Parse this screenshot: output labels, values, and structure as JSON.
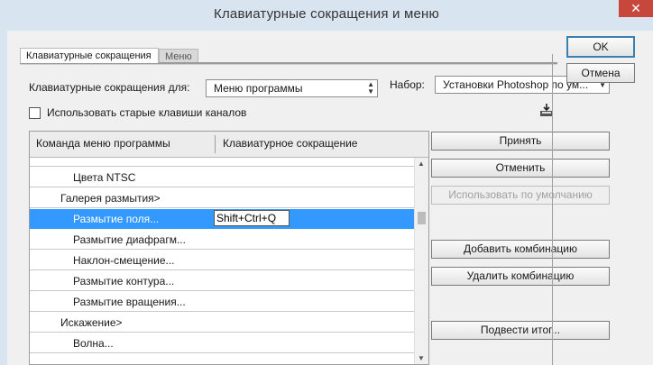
{
  "window": {
    "title": "Клавиатурные сокращения и меню",
    "close_glyph": "✕"
  },
  "tabs": [
    {
      "label": "Клавиатурные сокращения",
      "active": true
    },
    {
      "label": "Меню",
      "active": false
    }
  ],
  "controls": {
    "shortcuts_for_label": "Клавиатурные сокращения для:",
    "shortcuts_for_value": "Меню программы",
    "set_label": "Набор:",
    "set_value": "Установки Photoshop по ум...",
    "legacy_channels_label": "Использовать старые клавиши каналов",
    "legacy_channels_checked": false,
    "save_set_icon": "save-set-icon"
  },
  "table": {
    "columns": [
      "Команда меню программы",
      "Клавиатурное сокращение"
    ],
    "rows": [
      {
        "label": "Цвета NTSC",
        "shortcut": "",
        "selected": false
      },
      {
        "label": "Галерея размытия>",
        "shortcut": "",
        "selected": false
      },
      {
        "label": "Размытие поля...",
        "shortcut": "Shift+Ctrl+Q",
        "selected": true
      },
      {
        "label": "Размытие диафрагм...",
        "shortcut": "",
        "selected": false
      },
      {
        "label": "Наклон-смещение...",
        "shortcut": "",
        "selected": false
      },
      {
        "label": "Размытие контура...",
        "shortcut": "",
        "selected": false
      },
      {
        "label": "Размытие вращения...",
        "shortcut": "",
        "selected": false
      },
      {
        "label": "Искажение>",
        "shortcut": "",
        "selected": false
      },
      {
        "label": "Волна...",
        "shortcut": "",
        "selected": false
      }
    ]
  },
  "buttons": {
    "ok": "OK",
    "cancel_dialog": "Отмена",
    "accept": "Принять",
    "undo": "Отменить",
    "use_default": "Использовать по умолчанию",
    "add_shortcut": "Добавить комбинацию",
    "delete_shortcut": "Удалить комбинацию",
    "summarize": "Подвести итог..."
  },
  "colors": {
    "selection": "#3399ff",
    "window_bg": "#d9e4f1",
    "dialog_bg": "#f0f0f0"
  }
}
